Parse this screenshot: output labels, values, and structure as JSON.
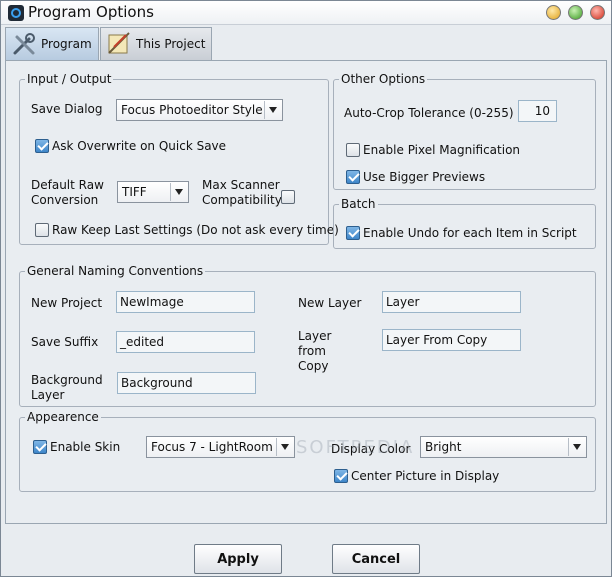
{
  "window": {
    "title": "Program Options"
  },
  "tabs": [
    {
      "label": "Program",
      "active": true
    },
    {
      "label": "This Project",
      "active": false
    }
  ],
  "input_output": {
    "legend": "Input / Output",
    "save_dialog_label": "Save Dialog",
    "save_dialog_value": "Focus Photoeditor Style",
    "ask_overwrite_label": "Ask Overwrite on Quick Save",
    "ask_overwrite_checked": true,
    "default_raw_label_1": "Default Raw",
    "default_raw_label_2": "Conversion",
    "default_raw_value": "TIFF",
    "max_scanner_label_1": "Max Scanner",
    "max_scanner_label_2": "Compatibility",
    "max_scanner_checked": false,
    "raw_keep_label": "Raw Keep Last Settings (Do not ask every time)",
    "raw_keep_checked": false
  },
  "other_options": {
    "legend": "Other Options",
    "auto_crop_label": "Auto-Crop Tolerance (0-255)",
    "auto_crop_value": "10",
    "pixel_mag_label": "Enable Pixel Magnification",
    "pixel_mag_checked": false,
    "bigger_previews_label": "Use Bigger Previews",
    "bigger_previews_checked": true
  },
  "batch": {
    "legend": "Batch",
    "undo_label": "Enable Undo for each Item in Script",
    "undo_checked": true
  },
  "naming": {
    "legend": "General Naming Conventions",
    "new_project_label": "New Project",
    "new_project_value": "NewImage",
    "new_layer_label": "New Layer",
    "new_layer_value": "Layer",
    "save_suffix_label": "Save Suffix",
    "save_suffix_value": "_edited",
    "layer_from_copy_label_1": "Layer",
    "layer_from_copy_label_2": "from",
    "layer_from_copy_label_3": "Copy",
    "layer_from_copy_value": "Layer From Copy",
    "background_label_1": "Background",
    "background_label_2": "Layer",
    "background_value": "Background"
  },
  "appearance": {
    "legend": "Appearence",
    "enable_skin_label": "Enable Skin",
    "enable_skin_checked": true,
    "skin_value": "Focus 7 - LightRoom",
    "display_color_label": "Display Color",
    "display_color_value": "Bright",
    "center_picture_label": "Center Picture in Display",
    "center_picture_checked": true
  },
  "buttons": {
    "apply": "Apply",
    "cancel": "Cancel"
  },
  "watermark": "SOFTPEDIA"
}
